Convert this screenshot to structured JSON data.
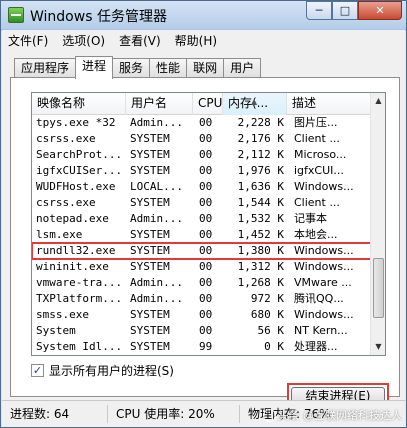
{
  "window": {
    "title": "Windows 任务管理器"
  },
  "titlebar_buttons": {
    "minimize": "─",
    "maximize": "□",
    "close": "✕"
  },
  "menu": [
    "文件(F)",
    "选项(O)",
    "查看(V)",
    "帮助(H)"
  ],
  "tabs": [
    {
      "label": "应用程序",
      "active": false
    },
    {
      "label": "进程",
      "active": true
    },
    {
      "label": "服务",
      "active": false
    },
    {
      "label": "性能",
      "active": false
    },
    {
      "label": "联网",
      "active": false
    },
    {
      "label": "用户",
      "active": false
    }
  ],
  "columns": [
    "映像名称",
    "用户名",
    "CPU",
    "内存(...",
    "描述"
  ],
  "processes": [
    {
      "name": "tpys.exe *32",
      "user": "Admin...",
      "cpu": "00",
      "mem": "2,228 K",
      "desc": "图片压..."
    },
    {
      "name": "csrss.exe",
      "user": "SYSTEM",
      "cpu": "00",
      "mem": "2,176 K",
      "desc": "Client ..."
    },
    {
      "name": "SearchProt...",
      "user": "SYSTEM",
      "cpu": "00",
      "mem": "2,112 K",
      "desc": "Microso..."
    },
    {
      "name": "igfxCUISer...",
      "user": "SYSTEM",
      "cpu": "00",
      "mem": "1,976 K",
      "desc": "igfxCUI..."
    },
    {
      "name": "WUDFHost.exe",
      "user": "LOCAL...",
      "cpu": "00",
      "mem": "1,636 K",
      "desc": "Windows..."
    },
    {
      "name": "csrss.exe",
      "user": "SYSTEM",
      "cpu": "00",
      "mem": "1,544 K",
      "desc": "Client ..."
    },
    {
      "name": "notepad.exe",
      "user": "Admin...",
      "cpu": "00",
      "mem": "1,532 K",
      "desc": "记事本"
    },
    {
      "name": "lsm.exe",
      "user": "SYSTEM",
      "cpu": "00",
      "mem": "1,452 K",
      "desc": "本地会..."
    },
    {
      "name": "rundll32.exe",
      "user": "SYSTEM",
      "cpu": "00",
      "mem": "1,380 K",
      "desc": "Windows..."
    },
    {
      "name": "wininit.exe",
      "user": "SYSTEM",
      "cpu": "00",
      "mem": "1,312 K",
      "desc": "Windows..."
    },
    {
      "name": "vmware-tra...",
      "user": "Admin...",
      "cpu": "00",
      "mem": "1,268 K",
      "desc": "VMware ..."
    },
    {
      "name": "TXPlatform...",
      "user": "Admin...",
      "cpu": "00",
      "mem": "972 K",
      "desc": "腾讯QQ..."
    },
    {
      "name": "smss.exe",
      "user": "SYSTEM",
      "cpu": "00",
      "mem": "680 K",
      "desc": "Windows..."
    },
    {
      "name": "System",
      "user": "SYSTEM",
      "cpu": "00",
      "mem": "56 K",
      "desc": "NT Kern..."
    },
    {
      "name": "System Idl...",
      "user": "SYSTEM",
      "cpu": "99",
      "mem": "0 K",
      "desc": "处理器..."
    }
  ],
  "selected_index": 8,
  "show_all_users": {
    "label": "显示所有用户的进程(S)",
    "checked": true,
    "mark": "✓"
  },
  "end_process_button": "结束进程(E)",
  "status": {
    "processes": "进程数: 64",
    "cpu": "CPU 使用率: 20%",
    "memory": "物理内存: 76%"
  },
  "watermark": "头条 @互联网络科技达人"
}
